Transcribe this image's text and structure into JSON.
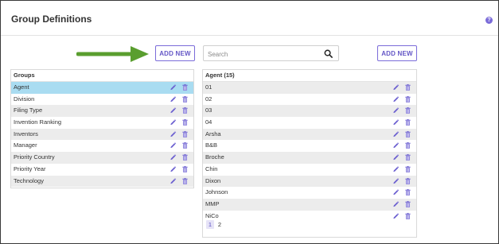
{
  "header": {
    "title": "Group Definitions",
    "help": "?"
  },
  "groups_add_button": "ADD NEW",
  "agent_add_button": "ADD NEW",
  "search": {
    "placeholder": "Search",
    "value": ""
  },
  "groups": {
    "title": "Groups",
    "items": [
      "Agent",
      "Division",
      "Filing Type",
      "Invention Ranking",
      "Inventors",
      "Manager",
      "Priority Country",
      "Priority Year",
      "Technology"
    ],
    "selected_index": 0
  },
  "agent": {
    "title": "Agent (15)",
    "items": [
      "01",
      "02",
      "03",
      "04",
      "Arsha",
      "B&B",
      "Broche",
      "Chin",
      "Dixon",
      "Johnson",
      "MMP",
      "NiCo"
    ]
  },
  "pagination": {
    "pages": [
      "1",
      "2"
    ],
    "current": "1"
  },
  "colors": {
    "accent": "#7b6cd9",
    "selected_row": "#a9dcf1",
    "arrow": "#5a9e2f"
  },
  "icons": {
    "edit": "pencil-icon",
    "delete": "trash-icon",
    "search": "search-icon",
    "help": "help-icon"
  }
}
